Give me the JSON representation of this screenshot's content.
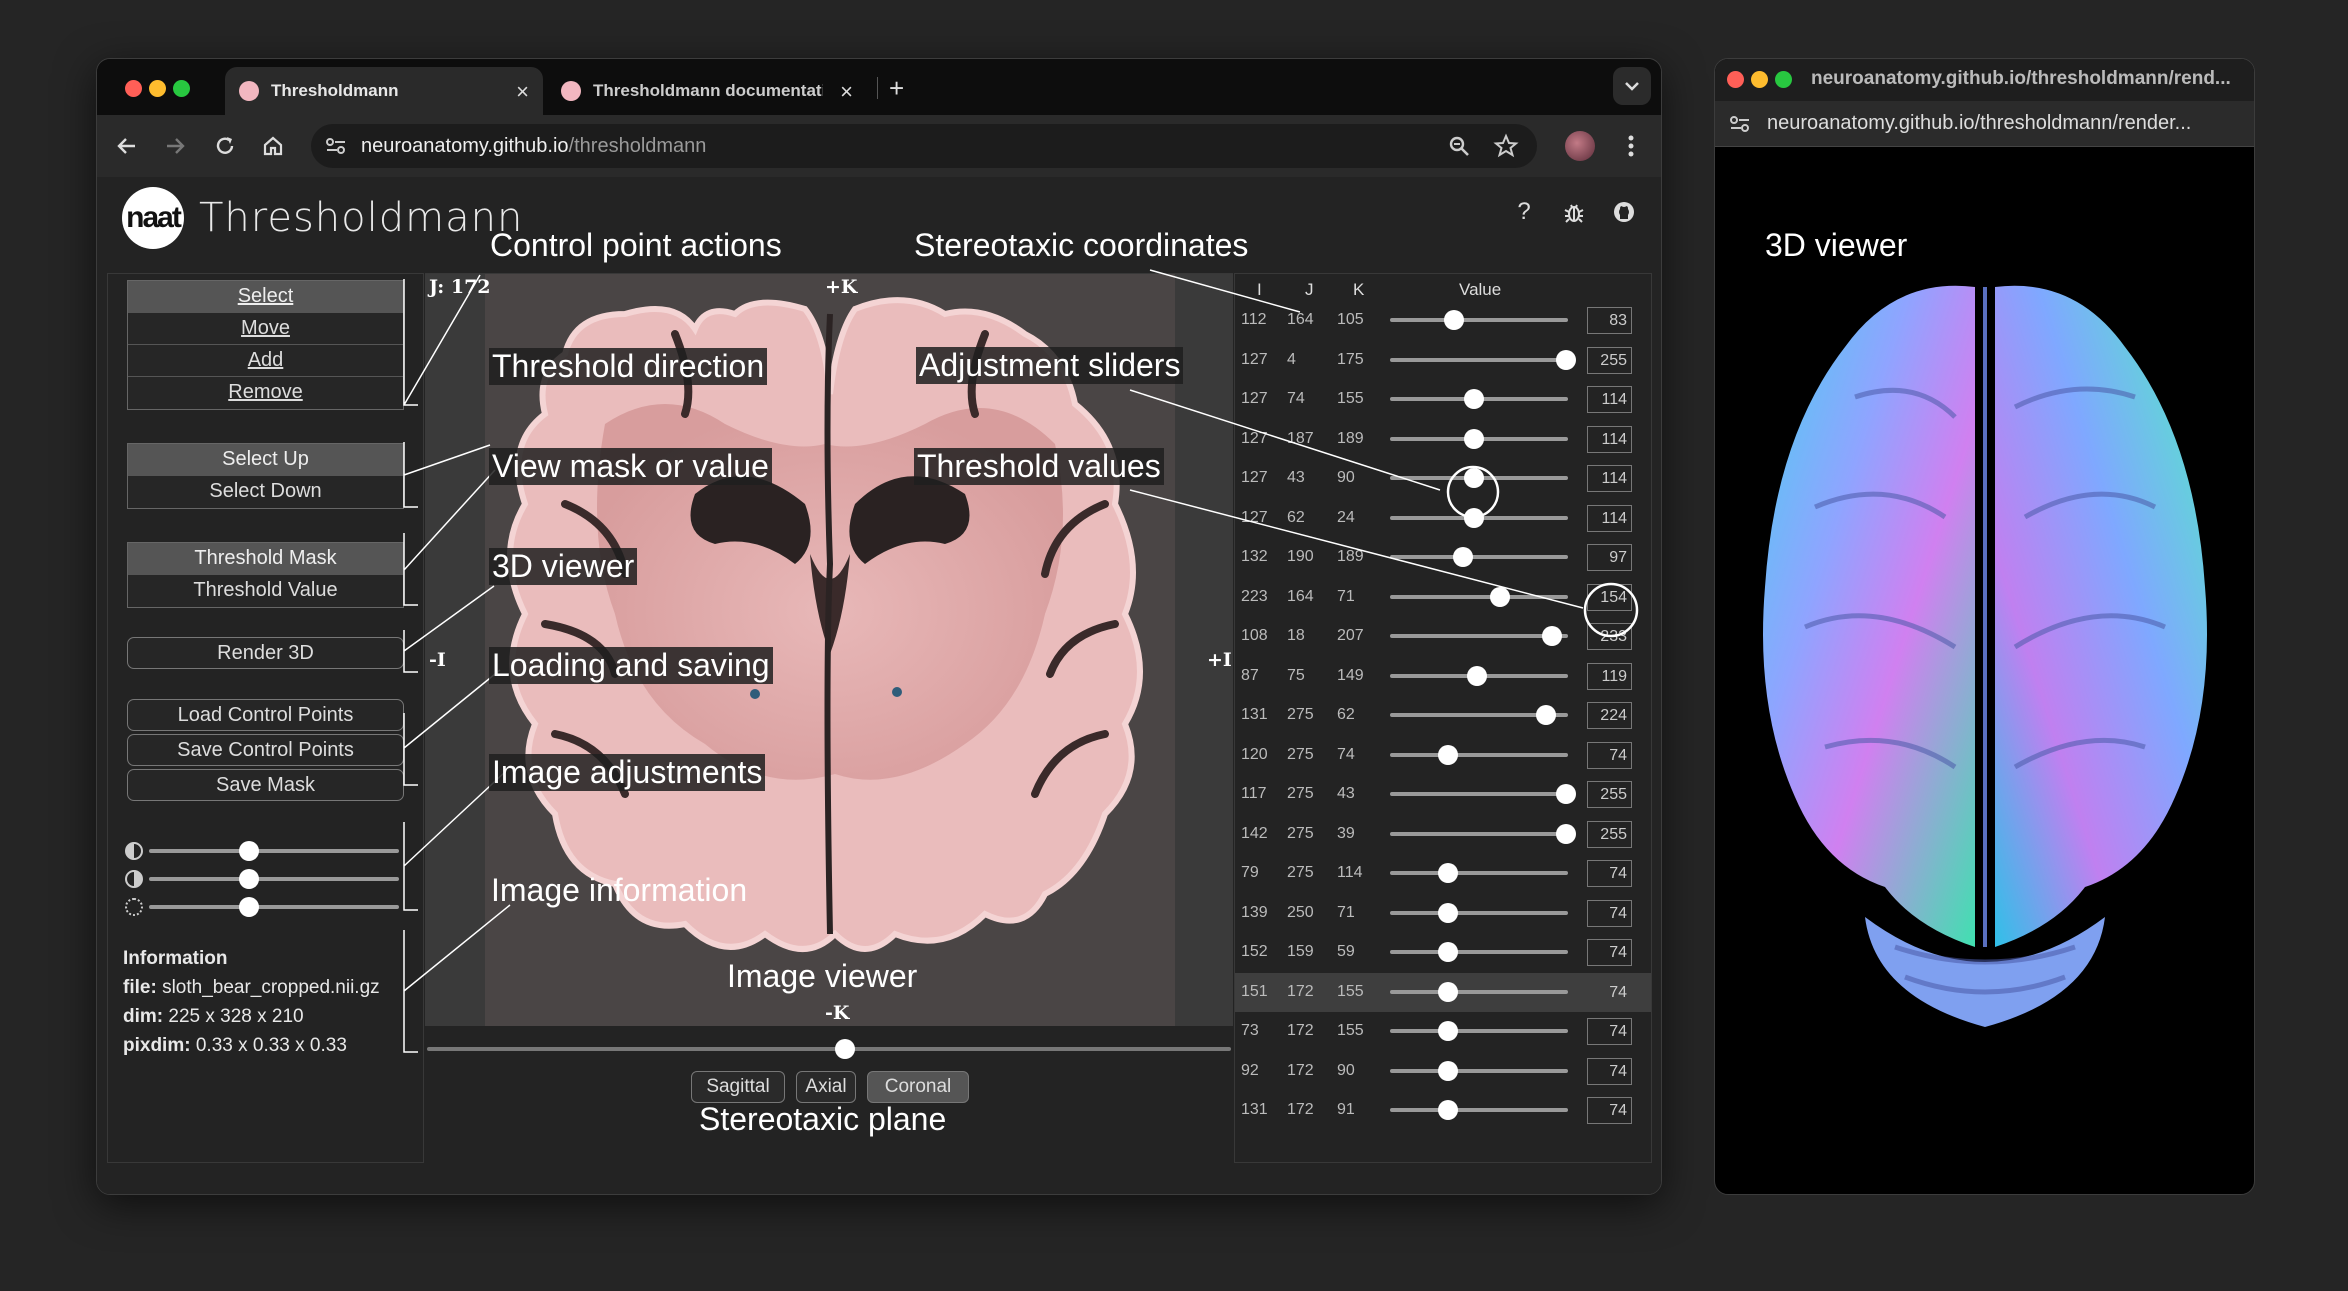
{
  "browser": {
    "tabs": [
      {
        "label": "Thresholdmann",
        "active": true
      },
      {
        "label": "Thresholdmann documentati",
        "active": false
      }
    ],
    "url_domain": "neuroanatomy.github.io",
    "url_path": "/thresholdmann"
  },
  "app": {
    "logo_text": "naat",
    "title": "Thresholdmann",
    "header_icons": [
      "help-icon",
      "bug-icon",
      "github-icon"
    ]
  },
  "control_points": {
    "buttons": [
      "Select",
      "Move",
      "Add",
      "Remove"
    ],
    "active": "Select"
  },
  "direction": {
    "buttons": [
      "Select Up",
      "Select Down"
    ],
    "active": "Select Up"
  },
  "display": {
    "buttons": [
      "Threshold Mask",
      "Threshold Value"
    ],
    "active": "Threshold Mask"
  },
  "render_button": "Render 3D",
  "io": {
    "load": "Load Control Points",
    "save_points": "Save Control Points",
    "save_mask": "Save Mask"
  },
  "adjustments": [
    {
      "icon": "brightness-icon",
      "value": 0.5
    },
    {
      "icon": "contrast-icon",
      "value": 0.5
    },
    {
      "icon": "sun-icon",
      "value": 0.5
    }
  ],
  "information": {
    "heading": "Information",
    "file_label": "file:",
    "file": "sloth_bear_cropped.nii.gz",
    "dim_label": "dim:",
    "dim": "225 x 328 x 210",
    "pixdim_label": "pixdim:",
    "pixdim": "0.33 x 0.33 x 0.33"
  },
  "viewer": {
    "slice_label": "J: 172",
    "top_label": "+K",
    "bottom_label": "-K",
    "left_label": "-I",
    "right_label": "+I",
    "slice_position": 0.52,
    "planes": [
      "Sagittal",
      "Axial",
      "Coronal"
    ],
    "active_plane": "Coronal"
  },
  "table": {
    "headers": [
      "I",
      "J",
      "K",
      "Value"
    ],
    "rows": [
      {
        "i": "112",
        "j": "164",
        "k": "105",
        "v": "83"
      },
      {
        "i": "127",
        "j": "4",
        "k": "175",
        "v": "255"
      },
      {
        "i": "127",
        "j": "74",
        "k": "155",
        "v": "114"
      },
      {
        "i": "127",
        "j": "187",
        "k": "189",
        "v": "114"
      },
      {
        "i": "127",
        "j": "43",
        "k": "90",
        "v": "114"
      },
      {
        "i": "127",
        "j": "62",
        "k": "24",
        "v": "114"
      },
      {
        "i": "132",
        "j": "190",
        "k": "189",
        "v": "97"
      },
      {
        "i": "223",
        "j": "164",
        "k": "71",
        "v": "154"
      },
      {
        "i": "108",
        "j": "18",
        "k": "207",
        "v": "233"
      },
      {
        "i": "87",
        "j": "75",
        "k": "149",
        "v": "119"
      },
      {
        "i": "131",
        "j": "275",
        "k": "62",
        "v": "224"
      },
      {
        "i": "120",
        "j": "275",
        "k": "74",
        "v": "74"
      },
      {
        "i": "117",
        "j": "275",
        "k": "43",
        "v": "255"
      },
      {
        "i": "142",
        "j": "275",
        "k": "39",
        "v": "255"
      },
      {
        "i": "79",
        "j": "275",
        "k": "114",
        "v": "74"
      },
      {
        "i": "139",
        "j": "250",
        "k": "71",
        "v": "74"
      },
      {
        "i": "152",
        "j": "159",
        "k": "59",
        "v": "74"
      },
      {
        "i": "151",
        "j": "172",
        "k": "155",
        "v": "74"
      },
      {
        "i": "73",
        "j": "172",
        "k": "155",
        "v": "74"
      },
      {
        "i": "92",
        "j": "172",
        "k": "90",
        "v": "74"
      },
      {
        "i": "131",
        "j": "172",
        "k": "91",
        "v": "74"
      }
    ],
    "highlighted_row": 17
  },
  "annotations": {
    "control_point_actions": "Control point actions",
    "stereotaxic_coordinates": "Stereotaxic coordinates",
    "threshold_direction": "Threshold direction",
    "adjustment_sliders": "Adjustment sliders",
    "view_mask_or_value": "View mask or value",
    "threshold_values": "Threshold values",
    "viewer_3d": "3D viewer",
    "loading_and_saving": "Loading and saving",
    "image_adjustments": "Image adjustments",
    "image_information": "Image information",
    "image_viewer": "Image viewer",
    "stereotaxic_plane": "Stereotaxic plane"
  },
  "side_window": {
    "title": "neuroanatomy.github.io/thresholdmann/rend...",
    "url": "neuroanatomy.github.io/thresholdmann/render...",
    "label": "3D viewer"
  }
}
